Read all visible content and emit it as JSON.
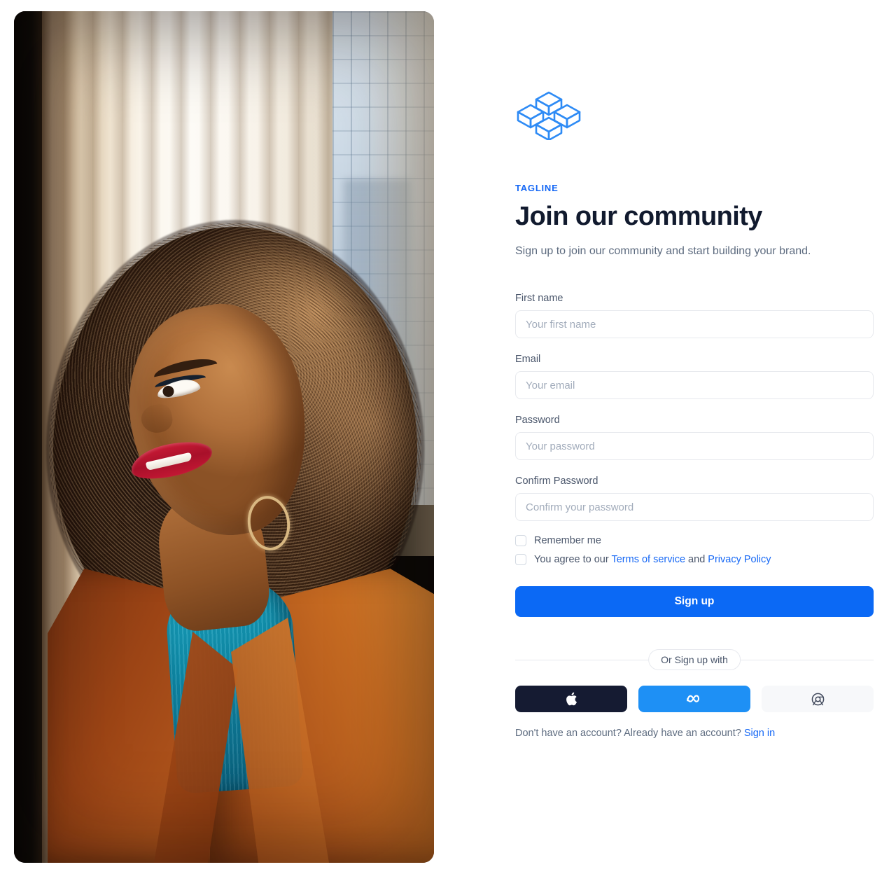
{
  "brand": {
    "logo_icon": "isometric-cubes-logo",
    "accent_color": "#1668f5",
    "primary_button_color": "#0b69f5"
  },
  "header": {
    "tagline": "TAGLINE",
    "headline": "Join our community",
    "subhead": "Sign up to join our community and start building your brand."
  },
  "form": {
    "fields": [
      {
        "label": "First name",
        "placeholder": "Your first name"
      },
      {
        "label": "Email",
        "placeholder": "Your email"
      },
      {
        "label": "Password",
        "placeholder": "Your password"
      },
      {
        "label": "Confirm Password",
        "placeholder": "Confirm your password"
      }
    ],
    "remember_me": "Remember me",
    "terms_prefix": "You agree to our ",
    "terms_link": "Terms of service",
    "terms_middle": " and ",
    "privacy_link": "Privacy Policy",
    "submit_label": "Sign up"
  },
  "divider": {
    "label": "Or Sign up with"
  },
  "socials": [
    {
      "name": "apple",
      "icon": "apple-icon",
      "bg": "#151b32"
    },
    {
      "name": "meta",
      "icon": "meta-icon",
      "bg": "#1e90f5"
    },
    {
      "name": "google",
      "icon": "chrome-icon",
      "bg": "#f7f8fa"
    }
  ],
  "footer": {
    "text": "Don't have an account? Already have an account? ",
    "signin_link": "Sign in"
  },
  "photo": {
    "alt": "Woman with afro hair in rust blazer and teal turtleneck beside a bright window"
  }
}
